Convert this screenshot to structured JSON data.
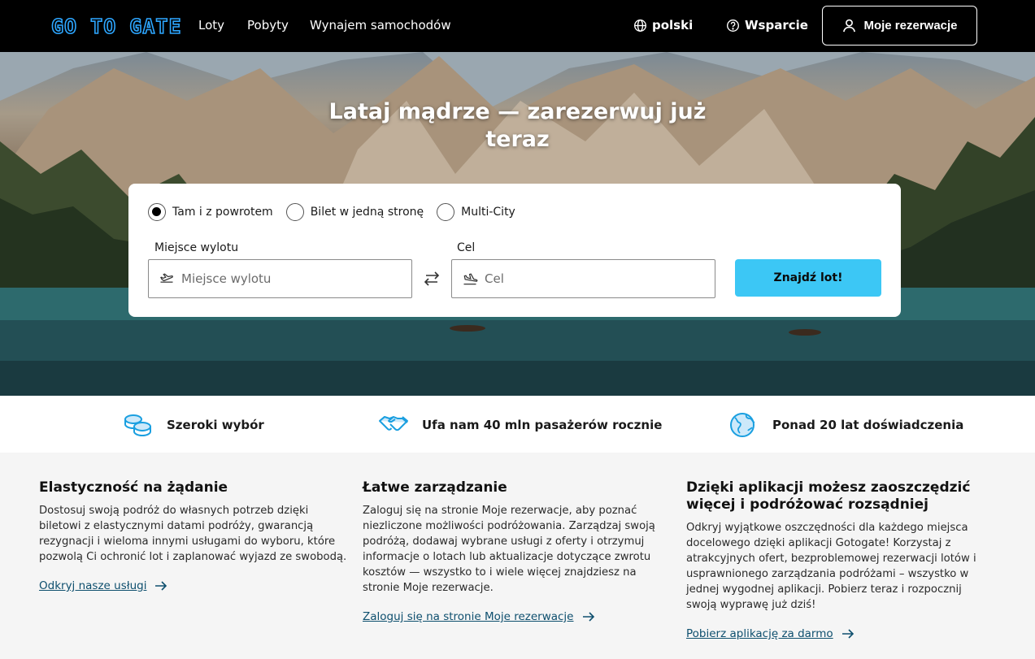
{
  "header": {
    "logo": "GO TO GATE",
    "nav": [
      "Loty",
      "Pobyty",
      "Wynajem samochodów"
    ],
    "language": "polski",
    "support": "Wsparcie",
    "my_bookings": "Moje rezerwacje"
  },
  "hero": {
    "title": "Lataj mądrze — zarezerwuj już teraz"
  },
  "search": {
    "trip_types": [
      {
        "label": "Tam i z powrotem",
        "checked": true
      },
      {
        "label": "Bilet w jedną stronę",
        "checked": false
      },
      {
        "label": "Multi-City",
        "checked": false
      }
    ],
    "origin_label": "Miejsce wylotu",
    "origin_placeholder": "Miejsce wylotu",
    "origin_value": "",
    "destination_label": "Cel",
    "destination_placeholder": "Cel",
    "destination_value": "",
    "submit_label": "Znajdź lot!"
  },
  "usps": [
    {
      "icon": "coins-icon",
      "label": "Szeroki wybór"
    },
    {
      "icon": "handshake-icon",
      "label": "Ufa nam 40 mln pasażerów rocznie"
    },
    {
      "icon": "globe-icon",
      "label": "Ponad 20 lat doświadczenia"
    }
  ],
  "info": [
    {
      "title": "Elastyczność na żądanie",
      "body": "Dostosuj swoją podróż do własnych potrzeb dzięki biletowi z elastycznymi datami podróży, gwarancją rezygnacji i wieloma innymi usługami do wyboru, które pozwolą Ci ochronić lot i zaplanować wyjazd ze swobodą.",
      "link": "Odkryj nasze usługi"
    },
    {
      "title": "Łatwe zarządzanie",
      "body": "Zaloguj się na stronie Moje rezerwacje, aby poznać niezliczone możliwości podróżowania. Zarządzaj swoją podróżą, dodawaj wybrane usługi z oferty i otrzymuj informacje o lotach lub aktualizacje dotyczące zwrotu kosztów — wszystko to i wiele więcej znajdziesz na stronie Moje rezerwacje.",
      "link": "Zaloguj się na stronie Moje rezerwacje"
    },
    {
      "title": "Dzięki aplikacji możesz zaoszczędzić więcej i podróżować rozsądniej",
      "body": "Odkryj wyjątkowe oszczędności dla każdego miejsca docelowego dzięki aplikacji Gotogate! Korzystaj z atrakcyjnych ofert, bezproblemowej rezerwacji lotów i usprawnionego zarządzania podróżami – wszystko w jednej wygodnej aplikacji. Pobierz teraz i rozpocznij swoją wyprawę już dziś!",
      "link": "Pobierz aplikację za darmo"
    }
  ],
  "colors": {
    "header_bg": "#000000",
    "logo_accent": "#2da6ff",
    "cta": "#3cc7f5",
    "link": "#0e4f6e",
    "icon_blue": "#1a9fe0"
  }
}
